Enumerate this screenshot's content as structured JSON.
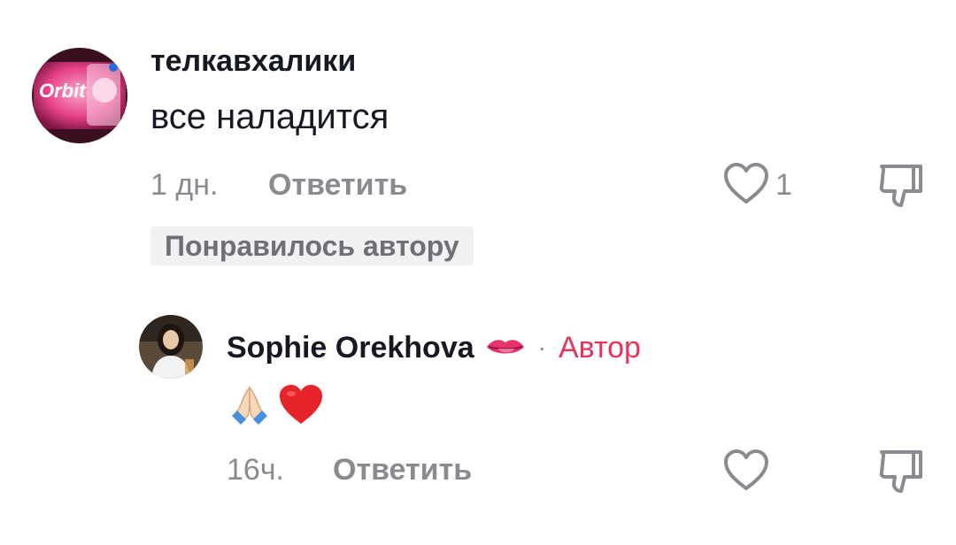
{
  "comment": {
    "username": "телкавхалики",
    "avatar_icon": "orbit-gum-avatar",
    "avatar_text": "Orbit",
    "text": "все наладится",
    "time": "1 дн.",
    "reply_label": "Ответить",
    "like_count": "1",
    "liked_by_author_label": "Понравилось автору"
  },
  "reply": {
    "username": "Sophie Orekhova",
    "name_emoji": "lips-icon",
    "separator": "·",
    "author_label": "Автор",
    "emojis": [
      "folded-hands-icon",
      "red-heart-icon"
    ],
    "time": "16ч.",
    "reply_label": "Ответить"
  },
  "colors": {
    "text_primary": "#161823",
    "text_secondary": "#8a8b91",
    "author_accent": "#e8325a",
    "badge_bg": "#f1f1f2"
  }
}
